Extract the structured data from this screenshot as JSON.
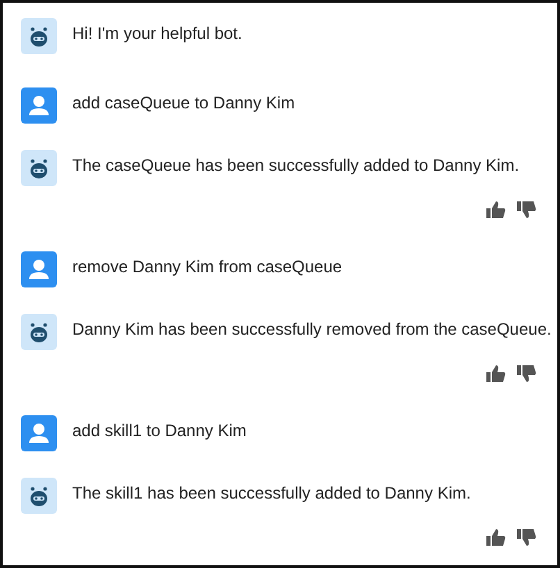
{
  "messages": [
    {
      "kind": "bot",
      "text": "Hi! I'm your helpful bot.",
      "feedback": false
    },
    {
      "kind": "user",
      "text": "add caseQueue to Danny Kim",
      "feedback": false
    },
    {
      "kind": "bot",
      "text": "The caseQueue has been successfully added to Danny Kim.",
      "feedback": true
    },
    {
      "kind": "user",
      "text": "remove Danny Kim from caseQueue",
      "feedback": false
    },
    {
      "kind": "bot",
      "text": "Danny Kim has been successfully removed from the caseQueue.",
      "feedback": true
    },
    {
      "kind": "user",
      "text": "add skill1 to Danny Kim",
      "feedback": false
    },
    {
      "kind": "bot",
      "text": "The skill1 has been successfully added to Danny Kim.",
      "feedback": true
    }
  ]
}
